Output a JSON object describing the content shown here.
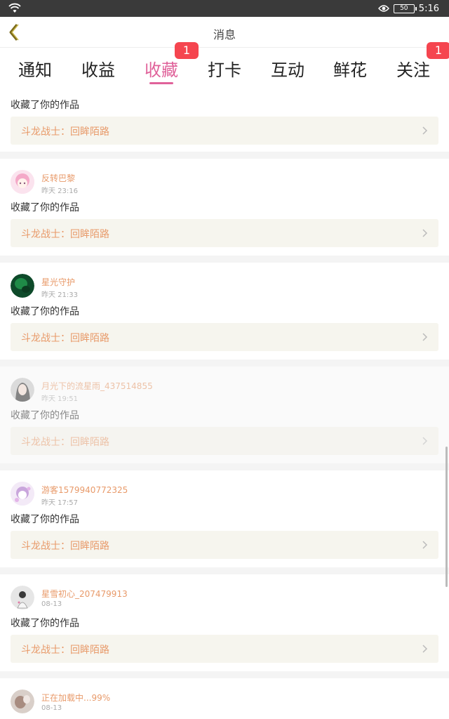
{
  "status": {
    "battery": "50",
    "time": "5:16",
    "icons": [
      "wifi-icon",
      "eye-icon",
      "battery-icon"
    ]
  },
  "header": {
    "title": "消息",
    "back_icon": "chevron-left-icon"
  },
  "tabs": [
    {
      "label": "通知"
    },
    {
      "label": "收益"
    },
    {
      "label": "收藏",
      "badge": "1",
      "active": true
    },
    {
      "label": "打卡"
    },
    {
      "label": "互动"
    },
    {
      "label": "鲜花"
    },
    {
      "label": "关注",
      "badge": "1"
    }
  ],
  "feed": [
    {
      "action": "收藏了你的作品",
      "work": "斗龙战士：回眸陌路"
    },
    {
      "user": "反转巴黎",
      "time": "昨天 23:16",
      "action": "收藏了你的作品",
      "work": "斗龙战士：回眸陌路"
    },
    {
      "user": "星光守护",
      "time": "昨天 21:33",
      "action": "收藏了你的作品",
      "work": "斗龙战士：回眸陌路"
    },
    {
      "user": "月光下的流星雨_437514855",
      "time": "昨天 19:51",
      "action": "收藏了你的作品",
      "work": "斗龙战士：回眸陌路"
    },
    {
      "user": "游客1579940772325",
      "time": "昨天 17:57",
      "action": "收藏了你的作品",
      "work": "斗龙战士：回眸陌路"
    },
    {
      "user": "星雪初心_207479913",
      "time": "08-13",
      "action": "收藏了你的作品",
      "work": "斗龙战士：回眸陌路"
    },
    {
      "user": "正在加载中...99%",
      "time": "08-13"
    }
  ],
  "colors": {
    "accent": "#e0629a",
    "badge": "#f5454f",
    "username": "#e89a6a",
    "work_bg": "#f6f5ee"
  }
}
